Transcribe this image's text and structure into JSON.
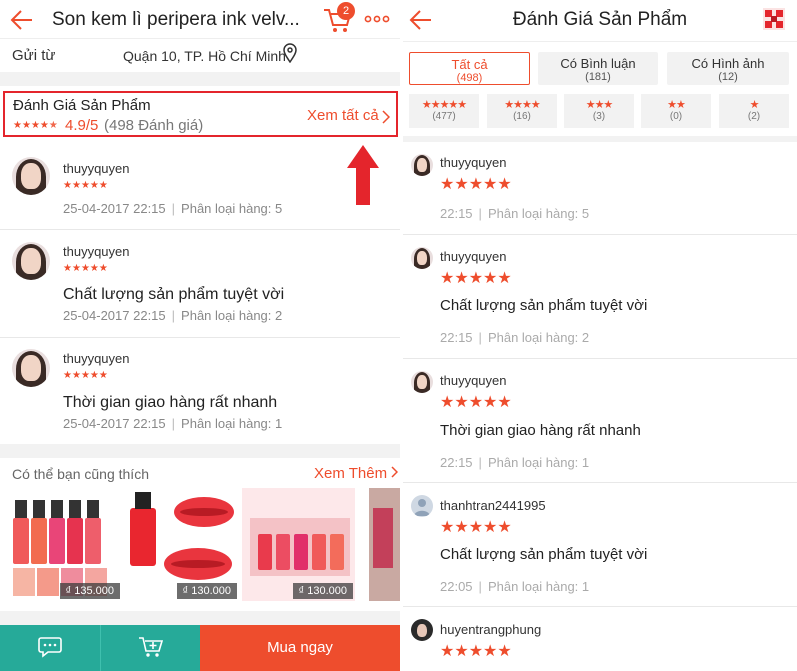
{
  "left": {
    "header": {
      "title": "Son kem lì peripera ink velv...",
      "cart_count": "2"
    },
    "shipping": {
      "label": "Gửi từ",
      "value": "Quận 10, TP. Hồ Chí Minh"
    },
    "review_summary": {
      "title": "Đánh Giá Sản Phẩm",
      "rating": 4.9,
      "score": "4.9/5",
      "count": "(498 Đánh giá)",
      "link": "Xem tất cả"
    },
    "reviews": [
      {
        "user": "thuyyquyen",
        "stars": 5,
        "comment": "",
        "date": "25-04-2017 22:15",
        "variant": "Phân loại hàng: 5"
      },
      {
        "user": "thuyyquyen",
        "stars": 5,
        "comment": "Chất lượng sản phẩm tuyệt vời",
        "date": "25-04-2017 22:15",
        "variant": "Phân loại hàng: 2"
      },
      {
        "user": "thuyyquyen",
        "stars": 5,
        "comment": "Thời gian giao hàng rất nhanh",
        "date": "25-04-2017 22:15",
        "variant": "Phân loại hàng: 1"
      }
    ],
    "suggestions": {
      "title": "Có thể bạn cũng thích",
      "link": "Xem Thêm",
      "products": [
        {
          "price": "₫ 135.000"
        },
        {
          "price": "₫ 130.000"
        },
        {
          "price": "₫ 130.000"
        }
      ]
    },
    "bottom_bar": {
      "buy_label": "Mua ngay"
    }
  },
  "right": {
    "header": {
      "title": "Đánh Giá Sản Phẩm"
    },
    "filters": [
      {
        "label": "Tất cả",
        "count": "(498)",
        "active": true
      },
      {
        "label": "Có Bình luận",
        "count": "(181)",
        "active": false
      },
      {
        "label": "Có Hình ảnh",
        "count": "(12)",
        "active": false
      }
    ],
    "star_filters": [
      {
        "stars": 5,
        "count": "(477)"
      },
      {
        "stars": 4,
        "count": "(16)"
      },
      {
        "stars": 3,
        "count": "(3)"
      },
      {
        "stars": 2,
        "count": "(0)"
      },
      {
        "stars": 1,
        "count": "(2)"
      }
    ],
    "reviews": [
      {
        "user": "thuyyquyen",
        "stars": 5,
        "comment": "",
        "time": "22:15",
        "variant": "Phân loại hàng: 5"
      },
      {
        "user": "thuyyquyen",
        "stars": 5,
        "comment": "Chất lượng sản phẩm tuyệt vời",
        "time": "22:15",
        "variant": "Phân loại hàng: 2"
      },
      {
        "user": "thuyyquyen",
        "stars": 5,
        "comment": "Thời gian giao hàng rất nhanh",
        "time": "22:15",
        "variant": "Phân loại hàng: 1"
      },
      {
        "user": "thanhtran2441995",
        "stars": 5,
        "comment": "Chất lượng sản phẩm tuyệt vời",
        "time": "22:05",
        "variant": "Phân loại hàng: 1"
      },
      {
        "user": "huyentrangphung",
        "stars": 5,
        "comment": "",
        "time": "",
        "variant": ""
      }
    ]
  },
  "colors": {
    "accent": "#ee4d2d",
    "highlight_border": "#e4252c",
    "teal": "#26aa99"
  },
  "icons": [
    "back-arrow-icon",
    "cart-icon",
    "more-icon",
    "location-pin-icon",
    "chevron-right-icon",
    "star-icon",
    "chat-icon",
    "add-to-cart-icon",
    "shop-logo-icon",
    "red-up-arrow"
  ]
}
